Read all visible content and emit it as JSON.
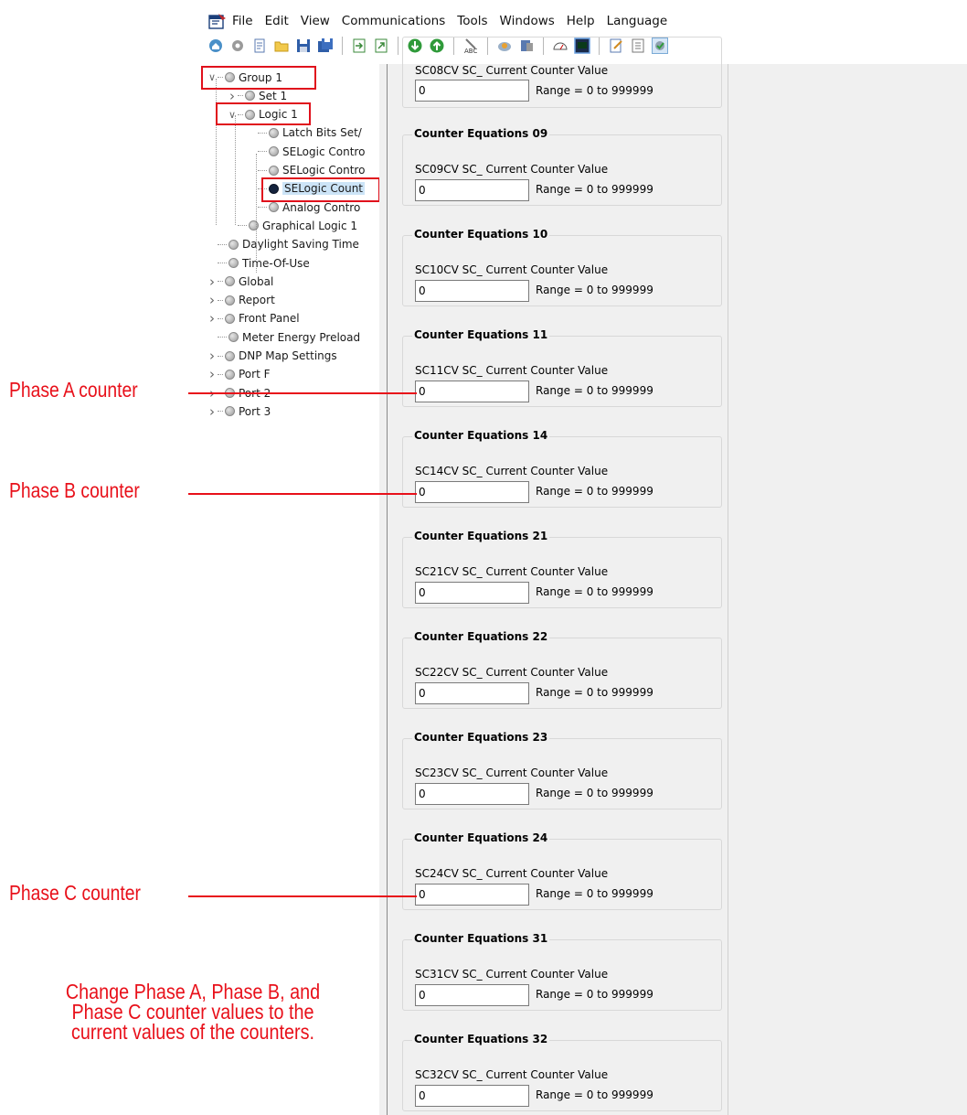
{
  "menu": [
    "File",
    "Edit",
    "View",
    "Communications",
    "Tools",
    "Windows",
    "Help",
    "Language"
  ],
  "toolbar": {
    "groups": [
      [
        "home-icon",
        "settings-icon",
        "document-icon",
        "open-folder-icon",
        "save-icon",
        "save-all-icon"
      ],
      [
        "import-icon",
        "export-icon"
      ],
      [
        "download-icon",
        "upload-icon"
      ],
      [
        "spell-check-icon"
      ],
      [
        "connect-icon",
        "database-icon"
      ],
      [
        "meter-icon",
        "terminal-icon"
      ],
      [
        "edit-icon",
        "list-icon",
        "gear-check-icon"
      ]
    ]
  },
  "tree": {
    "nodes": [
      {
        "label": "Group 1",
        "expander": "open"
      },
      {
        "label": "Set 1",
        "expander": "closed"
      },
      {
        "label": "Logic 1",
        "expander": "open"
      },
      {
        "label": "Latch Bits Set/",
        "expander": "none"
      },
      {
        "label": "SELogic Contro",
        "expander": "none"
      },
      {
        "label": "SELogic Contro",
        "expander": "none"
      },
      {
        "label": "SELogic Count",
        "expander": "none",
        "selected": true
      },
      {
        "label": "Analog Contro",
        "expander": "none"
      },
      {
        "label": "Graphical Logic 1",
        "expander": "none"
      },
      {
        "label": "Daylight Saving Time",
        "expander": "none"
      },
      {
        "label": "Time-Of-Use",
        "expander": "none"
      },
      {
        "label": "Global",
        "expander": "closed"
      },
      {
        "label": "Report",
        "expander": "closed"
      },
      {
        "label": "Front Panel",
        "expander": "closed"
      },
      {
        "label": "Meter Energy Preload",
        "expander": "none"
      },
      {
        "label": "DNP Map Settings",
        "expander": "closed"
      },
      {
        "label": "Port F",
        "expander": "closed"
      },
      {
        "label": "Port 2",
        "expander": "closed"
      },
      {
        "label": "Port 3",
        "expander": "closed"
      }
    ]
  },
  "counters": {
    "top_partial": {
      "label": "SC08CV  SC_ Current Counter Value",
      "value": "0",
      "range": "Range = 0 to 999999"
    },
    "groups": [
      {
        "title": "Counter Equations 09",
        "label": "SC09CV  SC_ Current Counter Value",
        "value": "0",
        "range": "Range = 0 to 999999"
      },
      {
        "title": "Counter Equations 10",
        "label": "SC10CV  SC_ Current Counter Value",
        "value": "0",
        "range": "Range = 0 to 999999"
      },
      {
        "title": "Counter Equations 11",
        "label": "SC11CV  SC_ Current Counter Value",
        "value": "0",
        "range": "Range = 0 to 999999"
      },
      {
        "title": "Counter Equations 14",
        "label": "SC14CV  SC_ Current Counter Value",
        "value": "0",
        "range": "Range = 0 to 999999"
      },
      {
        "title": "Counter Equations 21",
        "label": "SC21CV  SC_ Current Counter Value",
        "value": "0",
        "range": "Range = 0 to 999999"
      },
      {
        "title": "Counter Equations 22",
        "label": "SC22CV  SC_ Current Counter Value",
        "value": "0",
        "range": "Range = 0 to 999999"
      },
      {
        "title": "Counter Equations 23",
        "label": "SC23CV  SC_ Current Counter Value",
        "value": "0",
        "range": "Range = 0 to 999999"
      },
      {
        "title": "Counter Equations 24",
        "label": "SC24CV  SC_ Current Counter Value",
        "value": "0",
        "range": "Range = 0 to 999999"
      },
      {
        "title": "Counter Equations 31",
        "label": "SC31CV  SC_ Current Counter Value",
        "value": "0",
        "range": "Range = 0 to 999999"
      },
      {
        "title": "Counter Equations 32",
        "label": "SC32CV  SC_ Current Counter Value",
        "value": "0",
        "range": "Range = 0 to 999999"
      }
    ]
  },
  "annotations": {
    "phase_a": "Phase A counter",
    "phase_b": "Phase B counter",
    "phase_c": "Phase C counter",
    "note": [
      "Change Phase A, Phase B, and",
      "Phase C counter values to the",
      "current values of the counters."
    ]
  },
  "colors": {
    "annotation": "#e8101a",
    "selection": "#cce4f7",
    "panel": "#f0f0f0"
  }
}
